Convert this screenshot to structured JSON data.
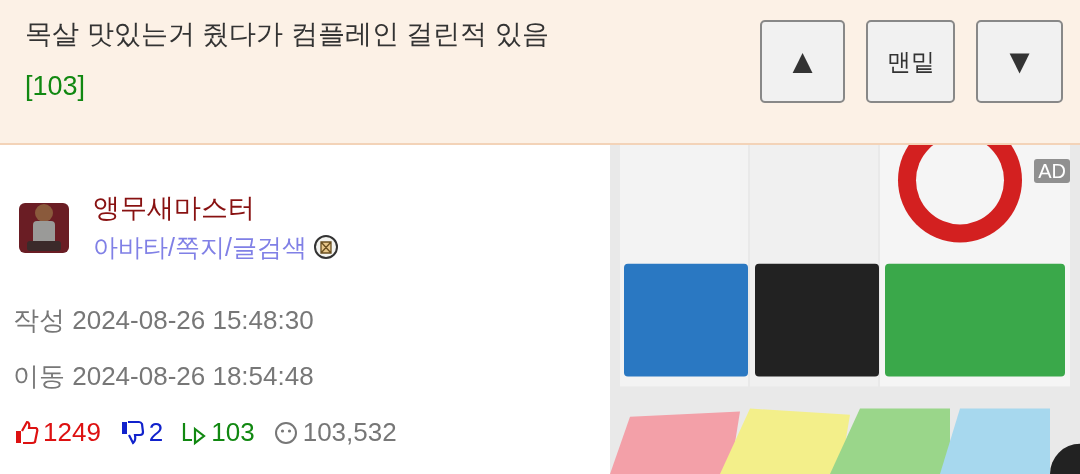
{
  "header": {
    "title": "목살 맛있는거 줬다가 컴플레인 걸린적 있음",
    "comment_count": "[103]",
    "buttons": [
      {
        "kind": "up",
        "label": "▲"
      },
      {
        "kind": "bottom",
        "label": "맨밑"
      },
      {
        "kind": "down",
        "label": "▼"
      }
    ]
  },
  "author": {
    "name": "앵무새마스터",
    "links": "아바타/쪽지/글검색"
  },
  "dates": [
    {
      "label": "작성",
      "value": "2024-08-26 15:48:30"
    },
    {
      "label": "이동",
      "value": "2024-08-26 18:54:48"
    }
  ],
  "stats": [
    {
      "kind": "up",
      "value": "1249",
      "color": "#dd1111"
    },
    {
      "kind": "down",
      "value": "2",
      "color": "#1122cc"
    },
    {
      "kind": "reply",
      "value": "103",
      "color": "#118811"
    },
    {
      "kind": "views",
      "value": "103,532",
      "color": "#777777"
    }
  ],
  "ad": {
    "badge": "AD"
  }
}
